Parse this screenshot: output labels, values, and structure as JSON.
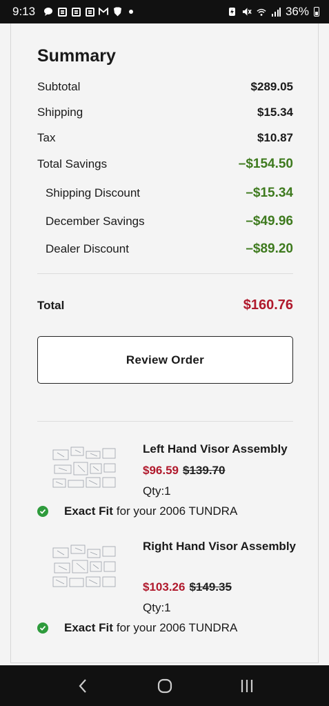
{
  "status_bar": {
    "time": "9:13",
    "battery_percent": "36%"
  },
  "summary": {
    "title": "Summary",
    "rows": [
      {
        "label": "Subtotal",
        "value": "$289.05"
      },
      {
        "label": "Shipping",
        "value": "$15.34"
      },
      {
        "label": "Tax",
        "value": "$10.87"
      },
      {
        "label": "Total Savings",
        "value": "–$154.50"
      },
      {
        "label": "Shipping Discount",
        "value": "–$15.34"
      },
      {
        "label": "December Savings",
        "value": "–$49.96"
      },
      {
        "label": "Dealer Discount",
        "value": "–$89.20"
      }
    ],
    "total_label": "Total",
    "total_value": "$160.76",
    "review_button": "Review Order"
  },
  "items": [
    {
      "name": "Left Hand Visor Assembly",
      "sale_price": "$96.59",
      "original_price": "$139.70",
      "qty": "Qty:1",
      "fit_strong": "Exact Fit",
      "fit_text": "for your 2006 TUNDRA"
    },
    {
      "name": "Right Hand Visor Assembly",
      "sale_price": "$103.26",
      "original_price": "$149.35",
      "qty": "Qty:1",
      "fit_strong": "Exact Fit",
      "fit_text": "for your 2006 TUNDRA"
    }
  ],
  "colors": {
    "savings_green": "#3e7a1e",
    "price_red": "#b0192c",
    "check_green": "#2e9b3c"
  }
}
